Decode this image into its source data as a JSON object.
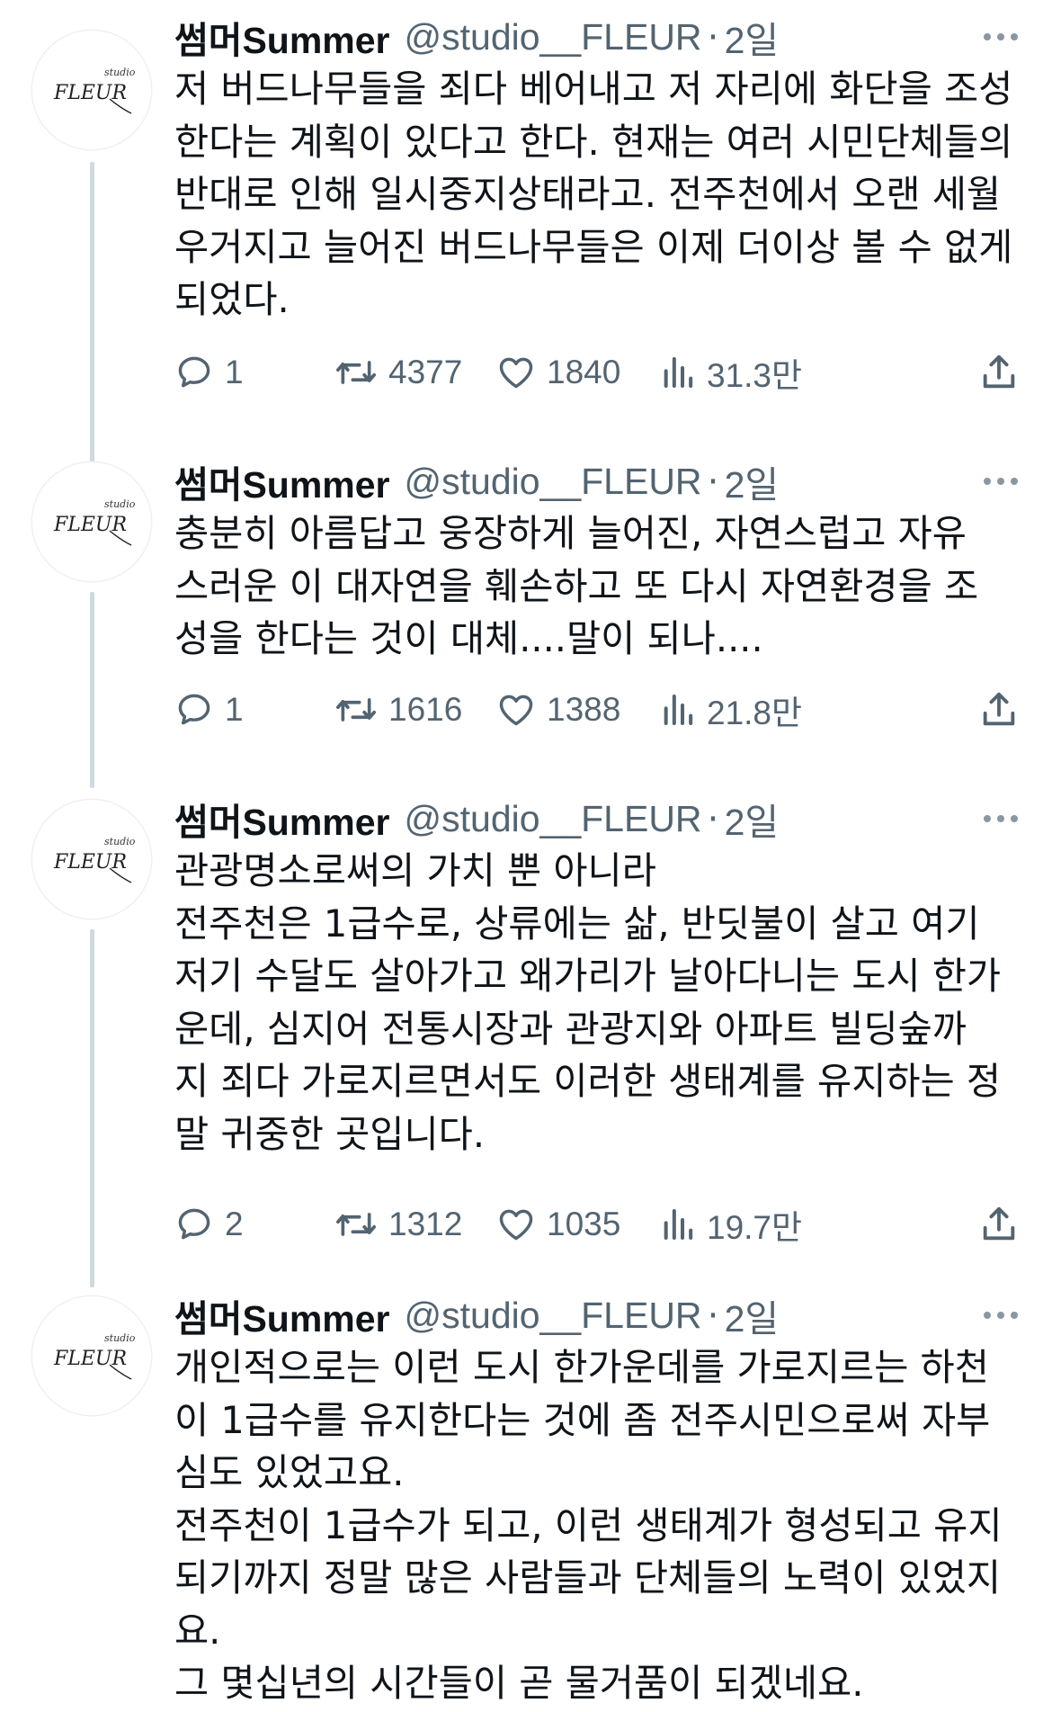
{
  "tweets": [
    {
      "name": "썸머Summer",
      "handle": "@studio__FLEUR",
      "time": "2일",
      "lines": [
        "저 버드나무들을 죄다 베어내고 저 자리에 화단을 조성",
        "한다는 계획이 있다고 한다. 현재는 여러 시민단체들의",
        "반대로 인해 일시중지상태라고. 전주천에서 오랜 세월",
        "우거지고 늘어진 버드나무들은 이제 더이상 볼 수 없게",
        "되었다."
      ],
      "replies": "1",
      "retweets": "4377",
      "likes": "1840",
      "views": "31.3만"
    },
    {
      "name": "썸머Summer",
      "handle": "@studio__FLEUR",
      "time": "2일",
      "lines": [
        "충분히 아름답고 웅장하게 늘어진, 자연스럽고 자유",
        "스러운 이 대자연을 훼손하고 또 다시 자연환경을 조",
        "성을 한다는 것이 대체....말이 되나...."
      ],
      "replies": "1",
      "retweets": "1616",
      "likes": "1388",
      "views": "21.8만"
    },
    {
      "name": "썸머Summer",
      "handle": "@studio__FLEUR",
      "time": "2일",
      "lines": [
        "관광명소로써의 가치 뿐 아니라",
        "전주천은 1급수로, 상류에는 삶, 반딧불이 살고 여기",
        "저기 수달도 살아가고 왜가리가 날아다니는 도시 한가",
        "운데, 심지어 전통시장과 관광지와 아파트 빌딩숲까",
        "지 죄다 가로지르면서도 이러한 생태계를 유지하는 정",
        "말 귀중한 곳입니다."
      ],
      "replies": "2",
      "retweets": "1312",
      "likes": "1035",
      "views": "19.7만"
    },
    {
      "name": "썸머Summer",
      "handle": "@studio__FLEUR",
      "time": "2일",
      "lines": [
        "개인적으로는 이런 도시 한가운데를 가로지르는 하천",
        "이 1급수를 유지한다는 것에 좀 전주시민으로써 자부",
        "심도 있었고요.",
        "전주천이 1급수가 되고, 이런 생태계가 형성되고 유지",
        "되기까지 정말 많은 사람들과 단체들의 노력이 있었지",
        "요.",
        "그 몇십년의 시간들이 곧 물거품이 되겠네요."
      ]
    }
  ],
  "avatar_logo": "FLEUR",
  "avatar_logo_small": "studio",
  "colors": {
    "text": "#0f1419",
    "secondary": "#536471",
    "thread_line": "#cfd9de"
  }
}
